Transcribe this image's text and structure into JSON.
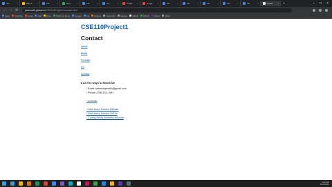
{
  "browser": {
    "tabs": [
      {
        "label": "Intr...",
        "color": "#4285f4"
      },
      {
        "label": "Blog 6",
        "color": "#fbbc04"
      },
      {
        "label": "Intr...",
        "color": "#4285f4"
      },
      {
        "label": "Mon...",
        "color": "#34a853"
      },
      {
        "label": "Intr...",
        "color": "#4285f4"
      },
      {
        "label": "Intr...",
        "color": "#4285f4"
      },
      {
        "label": "image...",
        "color": "#ea4335"
      },
      {
        "label": "image...",
        "color": "#ea4335"
      },
      {
        "label": "Intr...",
        "color": "#4285f4"
      },
      {
        "label": "Intr...",
        "color": "#4285f4"
      },
      {
        "label": "Intr...",
        "color": "#4285f4"
      },
      {
        "label": "Intr...",
        "color": "#4285f4"
      },
      {
        "label": "Intr...",
        "color": "#4285f4"
      },
      {
        "label": "Conta",
        "color": "#e8eaed",
        "active": true
      }
    ],
    "new_tab": "+",
    "url_host": "jadesmith.github.io",
    "url_path": "/CSE110Project1/contact.html",
    "bookmarks": [
      "Apps",
      "YouTube",
      "Gmail",
      "Mail",
      "Drive",
      "Work Fix Items",
      "Google",
      "Cal",
      "Canvas",
      "Class Info",
      "Classes",
      "Github",
      "Rubric",
      "Yahoo",
      "Other"
    ]
  },
  "page": {
    "site_title": "CSE110Project1",
    "heading": "Contact",
    "nav": [
      "Home",
      "About",
      "Portfolio",
      "CV",
      "Contact"
    ],
    "section_label": "All The ways to Reach Me",
    "contact_items": [
      {
        "text": "□Email: tamesimpent64@gmail.com",
        "link": false
      },
      {
        "text": "□Phone: (208) 812-1991",
        "link": false
      },
      {
        "text": "□Linkedin",
        "link": true
      }
    ],
    "links": [
      "□Utah Wave Swimm Website",
      "□Utah Wave Swimm GoFub",
      "□Coding Minds Academy Website"
    ]
  },
  "taskbar": {
    "time": "5:31 AM",
    "date": "1/21/2022"
  }
}
